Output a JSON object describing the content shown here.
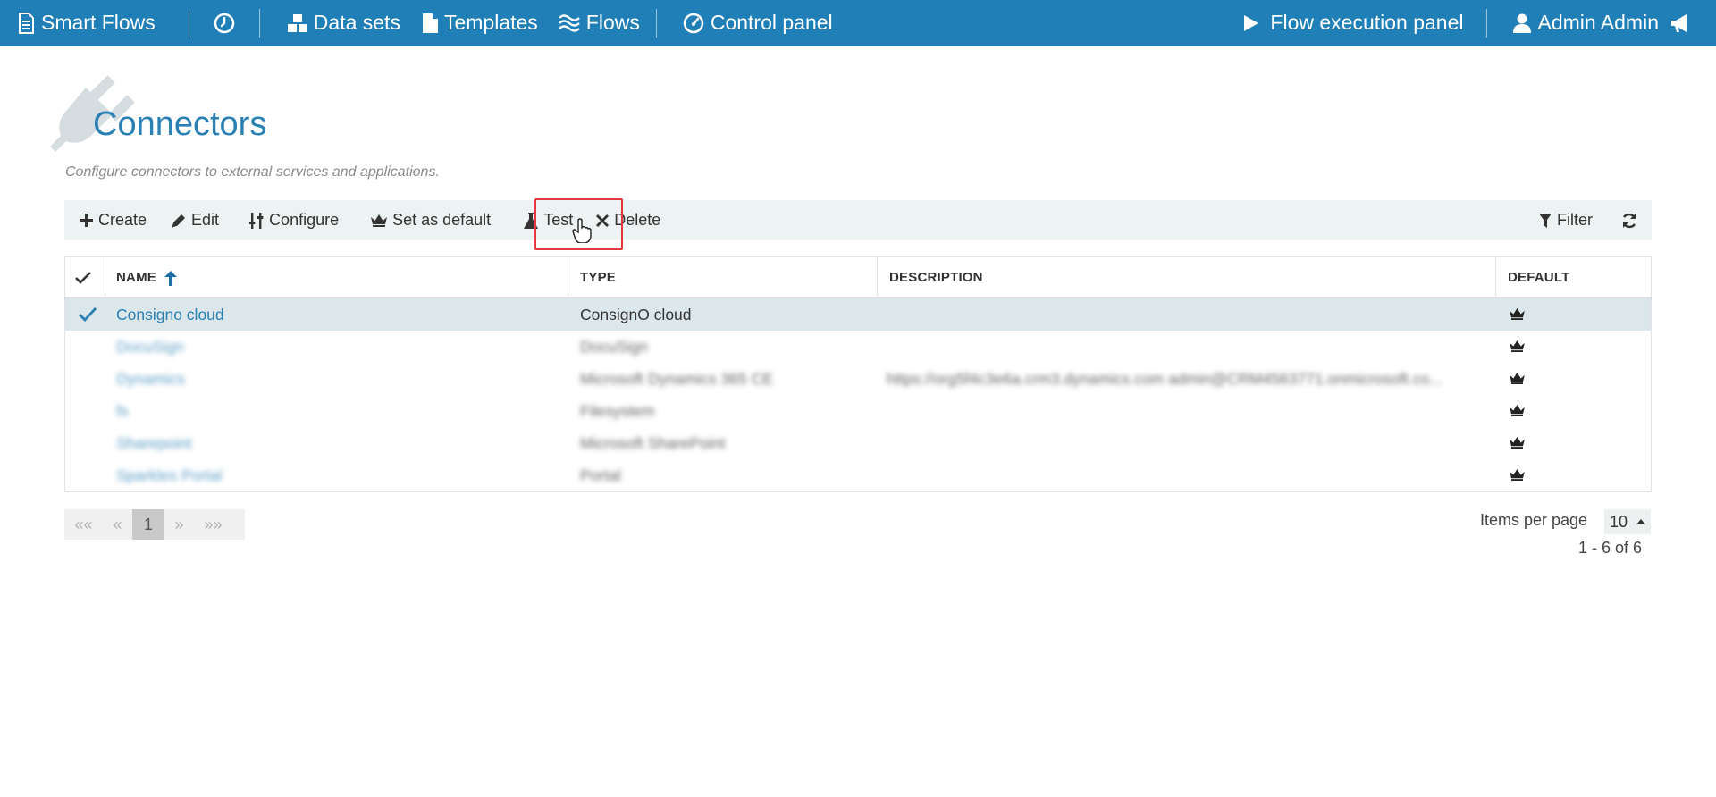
{
  "colors": {
    "brand": "#1f7fb6",
    "title": "#2a7fb3",
    "highlight": "#e0393e",
    "selected_row": "#dbe7ea"
  },
  "navbar": {
    "brand": "Smart Flows",
    "datasets": "Data sets",
    "templates": "Templates",
    "flows": "Flows",
    "control_panel": "Control panel",
    "execution_panel": "Flow execution panel",
    "user": "Admin Admin"
  },
  "header": {
    "title": "Connectors",
    "subtitle": "Configure connectors to external services and applications."
  },
  "toolbar": {
    "create": "Create",
    "edit": "Edit",
    "configure": "Configure",
    "set_default": "Set as default",
    "test": "Test",
    "delete": "Delete",
    "filter": "Filter"
  },
  "table": {
    "columns": {
      "name": "NAME",
      "type": "TYPE",
      "description": "DESCRIPTION",
      "default": "DEFAULT"
    },
    "rows": [
      {
        "name": "Consigno cloud",
        "type": "ConsignO cloud",
        "description": "",
        "selected": true
      },
      {
        "name": "DocuSign",
        "type": "DocuSign",
        "description": "",
        "selected": false
      },
      {
        "name": "Dynamics",
        "type": "Microsoft Dynamics 365 CE",
        "description": "https://org5f4c3e6a.crm3.dynamics.com admin@CRM4563771.onmicrosoft.co...",
        "selected": false
      },
      {
        "name": "fs",
        "type": "Filesystem",
        "description": "",
        "selected": false
      },
      {
        "name": "Sharepoint",
        "type": "Microsoft SharePoint",
        "description": "",
        "selected": false
      },
      {
        "name": "Sparkles Portal",
        "type": "Portal",
        "description": "",
        "selected": false
      }
    ]
  },
  "pagination": {
    "first": "««",
    "prev": "«",
    "current": "1",
    "next": "»",
    "last": "»»",
    "items_per_page_label": "Items per page",
    "items_per_page_value": "10",
    "range": "1 - 6 of 6"
  }
}
